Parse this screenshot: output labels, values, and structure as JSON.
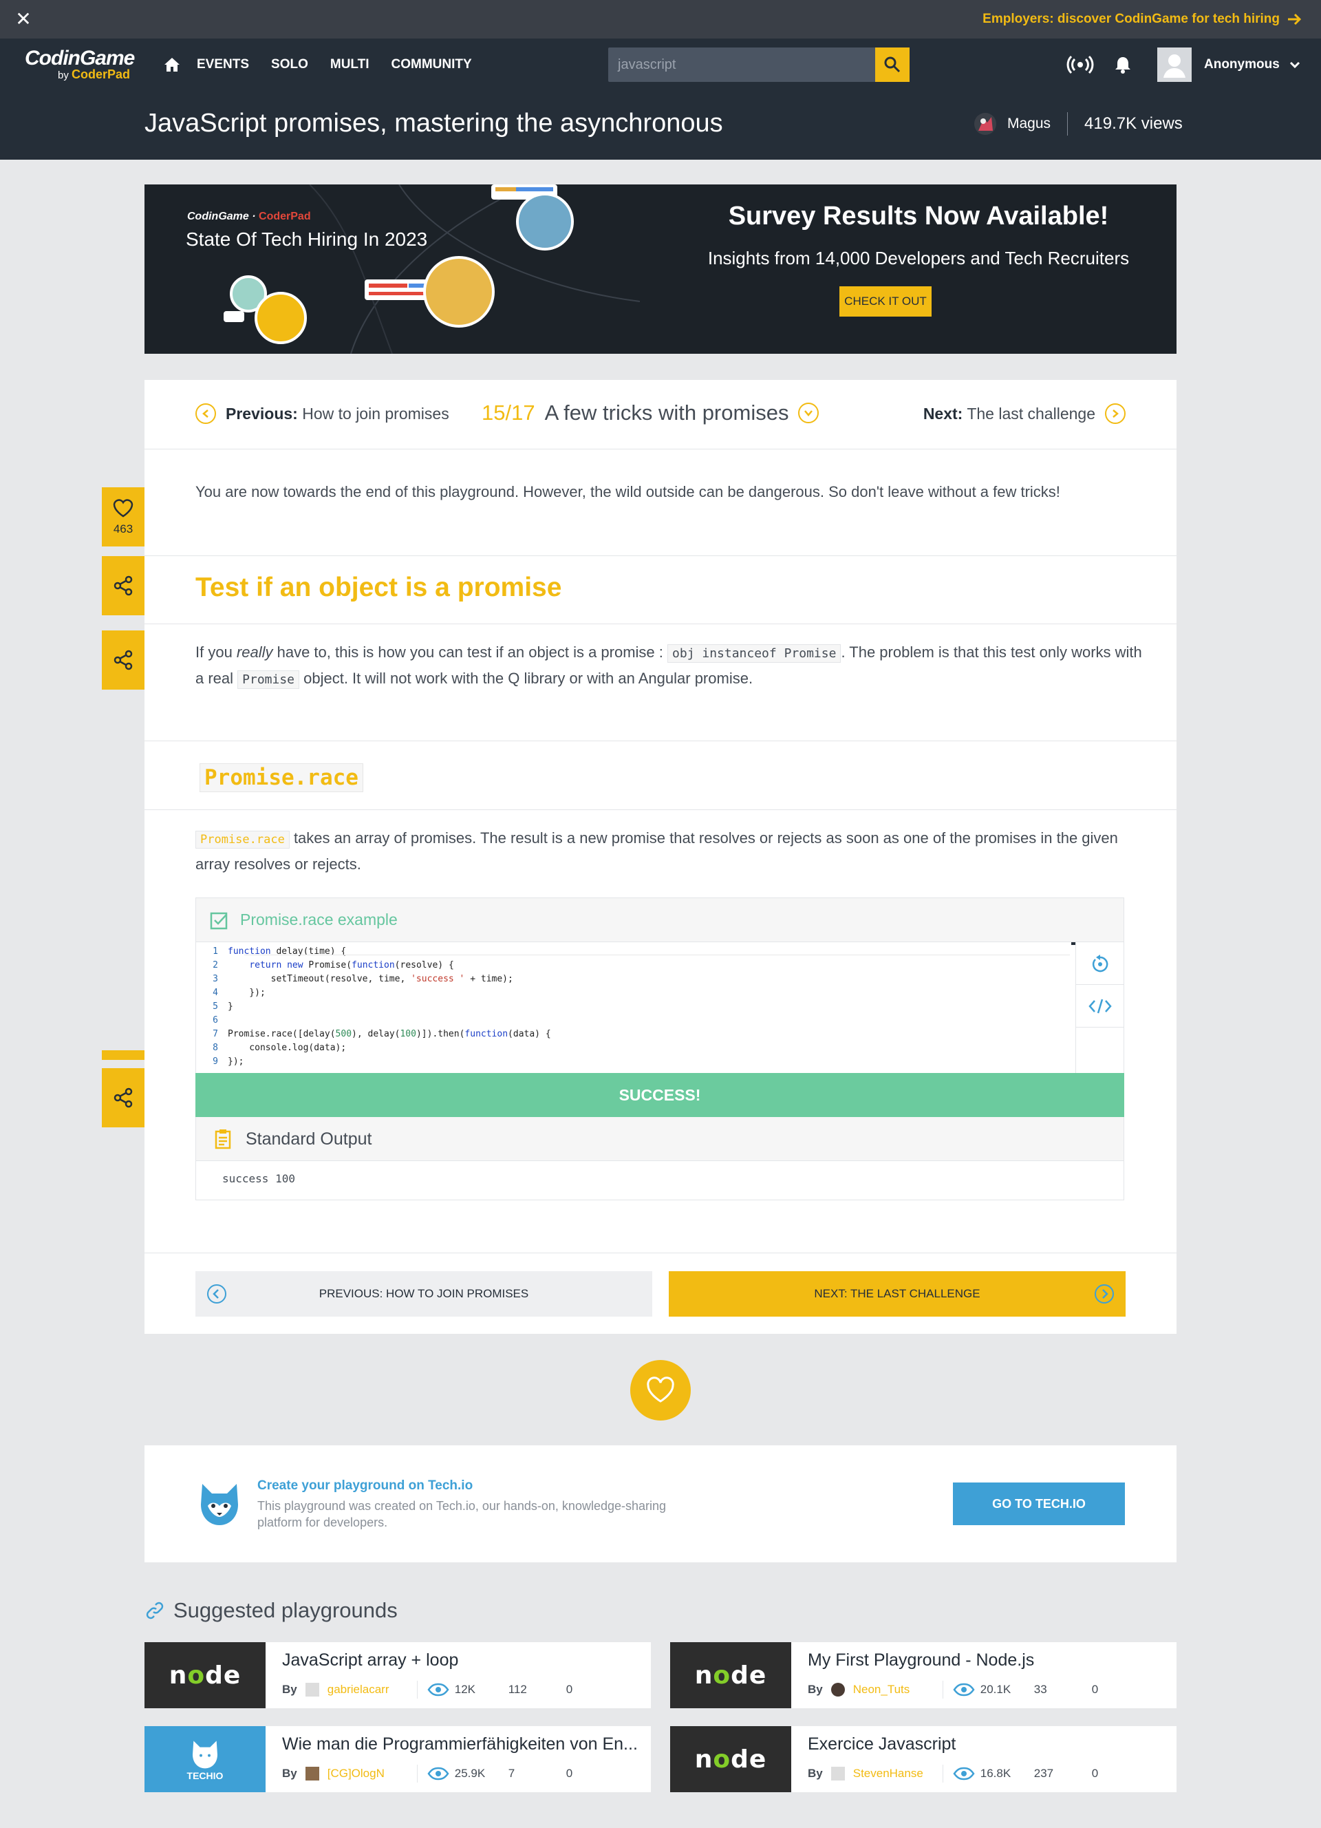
{
  "topbar": {
    "employers_text": "Employers: discover CodinGame for tech hiring"
  },
  "nav": {
    "logo_main": "CodinGame",
    "logo_by": "by",
    "logo_sub": "CoderPad",
    "links": [
      "EVENTS",
      "SOLO",
      "MULTI",
      "COMMUNITY"
    ],
    "search_placeholder": "javascript",
    "user_name": "Anonymous"
  },
  "title_bar": {
    "title": "JavaScript promises, mastering the asynchronous",
    "author": "Magus",
    "views": "419.7K views"
  },
  "banner": {
    "brand_a": "CodinGame",
    "brand_b": "CoderPad",
    "subtitle": "State Of Tech Hiring In 2023",
    "headline": "Survey Results Now Available!",
    "insight": "Insights from 14,000 Developers and Tech Recruiters",
    "cta": "CHECK IT OUT"
  },
  "pager": {
    "prev_label": "Previous:",
    "prev_title": "How to join promises",
    "current_index": "15/17",
    "current_title": "A few tricks with promises",
    "next_label": "Next:",
    "next_title": "The last challenge"
  },
  "content": {
    "intro": "You are now towards the end of this playground. However, the wild outside can be dangerous. So don't leave without a few tricks!",
    "section1_title": "Test if an object is a promise",
    "s1_a": "If you ",
    "s1_em": "really",
    "s1_b": " have to, this is how you can test if an object is a promise : ",
    "s1_code1": "obj instanceof Promise",
    "s1_c": ". The problem is that this test only works with a real ",
    "s1_code2": "Promise",
    "s1_d": " object. It will not work with the Q library or with an Angular promise.",
    "section2_title": "Promise.race",
    "s2_code": "Promise.race",
    "s2_text": " takes an array of promises. The result is a new promise that resolves or rejects as soon as one of the promises in the given array resolves or rejects."
  },
  "widget": {
    "title": "Promise.race example",
    "code_lines": [
      "function delay(time) {",
      "    return new Promise(function(resolve) {",
      "        setTimeout(resolve, time, 'success ' + time);",
      "    });",
      "}",
      "",
      "Promise.race([delay(500), delay(100)]).then(function(data) {",
      "    console.log(data);",
      "});"
    ],
    "status": "SUCCESS!",
    "output_title": "Standard Output",
    "output": "success 100"
  },
  "bottom_nav": {
    "prev": "PREVIOUS: HOW TO JOIN PROMISES",
    "next": "NEXT: THE LAST CHALLENGE"
  },
  "side": {
    "likes": "463"
  },
  "techio": {
    "title": "Create your playground on Tech.io",
    "desc": "This playground was created on Tech.io, our hands-on, knowledge-sharing platform for developers.",
    "button": "GO TO TECH.IO"
  },
  "suggested": {
    "title": "Suggested playgrounds",
    "items": [
      {
        "title": "JavaScript array + loop",
        "by": "By",
        "author": "gabrielacarr",
        "views": "12K",
        "likes": "112",
        "comments": "0",
        "thumb": "node"
      },
      {
        "title": "My First Playground - Node.js",
        "by": "By",
        "author": "Neon_Tuts",
        "views": "20.1K",
        "likes": "33",
        "comments": "0",
        "thumb": "node"
      },
      {
        "title": "Wie man die Programmierfähigkeiten von En...",
        "by": "By",
        "author": "[CG]OlogN",
        "views": "25.9K",
        "likes": "7",
        "comments": "0",
        "thumb": "techio",
        "thumb_label": "TECHIO"
      },
      {
        "title": "Exercice Javascript",
        "by": "By",
        "author": "StevenHanse",
        "views": "16.8K",
        "likes": "237",
        "comments": "0",
        "thumb": "node"
      }
    ]
  },
  "colors": {
    "accent": "#f2bb13",
    "nav_bg": "#252e38",
    "success": "#6bcb9e",
    "techio_blue": "#3ea0d6"
  }
}
